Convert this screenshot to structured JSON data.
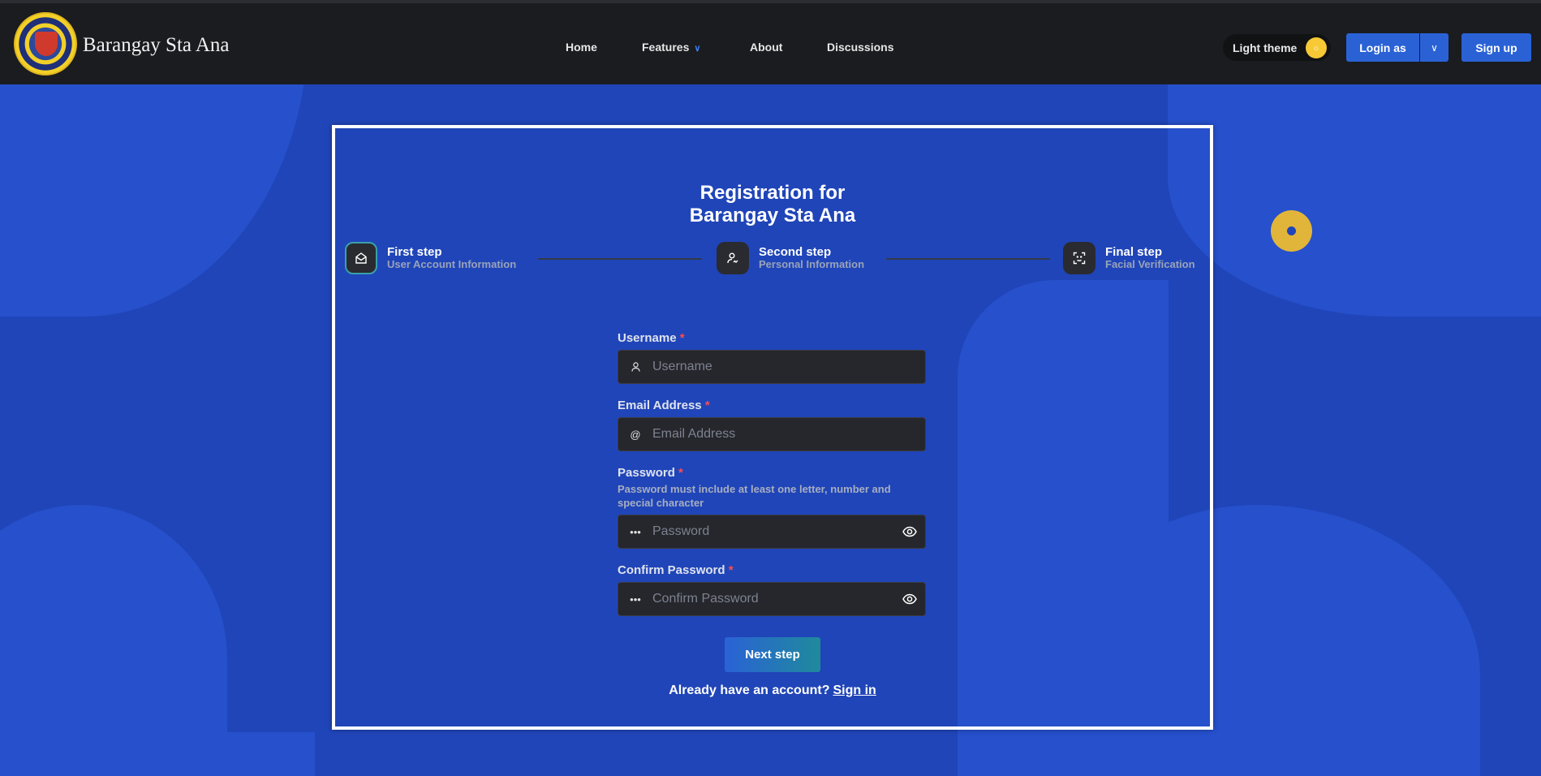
{
  "header": {
    "brand": "Barangay Sta Ana",
    "nav": {
      "home": "Home",
      "features": "Features",
      "about": "About",
      "discussions": "Discussions"
    },
    "theme_toggle_label": "Light theme",
    "login_label": "Login as",
    "signup_label": "Sign up"
  },
  "card": {
    "title_line1": "Registration for",
    "title_line2": "Barangay Sta Ana",
    "steps": [
      {
        "title": "First step",
        "subtitle": "User Account Information",
        "icon": "envelope-open-icon",
        "active": true
      },
      {
        "title": "Second step",
        "subtitle": "Personal Information",
        "icon": "user-sign-icon",
        "active": false
      },
      {
        "title": "Final step",
        "subtitle": "Facial Verification",
        "icon": "face-scan-icon",
        "active": false
      }
    ]
  },
  "form": {
    "username": {
      "label": "Username",
      "required_mark": "*",
      "placeholder": "Username"
    },
    "email": {
      "label": "Email Address",
      "required_mark": "*",
      "placeholder": "Email Address"
    },
    "password": {
      "label": "Password",
      "required_mark": "*",
      "hint": "Password must include at least one letter, number and special character",
      "placeholder": "Password"
    },
    "confirm_password": {
      "label": "Confirm Password",
      "required_mark": "*",
      "placeholder": "Confirm Password"
    },
    "next_label": "Next step",
    "have_account_text": "Already have an account?",
    "signin_label": "Sign in"
  },
  "colors": {
    "background": "#2045b8",
    "nav_bg": "#1b1c20",
    "accent": "#2a62d6",
    "theme_knob": "#f6c935",
    "required": "#ff4d4d"
  }
}
